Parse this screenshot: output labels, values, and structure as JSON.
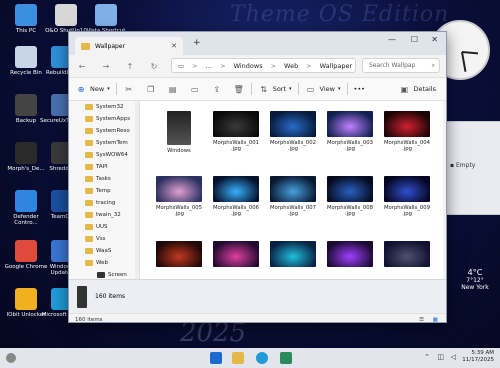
{
  "desktop": {
    "brand_top": "Theme OS Edition",
    "brand_bottom": "2025",
    "icons": [
      {
        "label": "This PC",
        "color": "#3c8fe0"
      },
      {
        "label": "O&O ShutUp10",
        "color": "#d7d7d7"
      },
      {
        "label": "Vista Shortcut",
        "color": "#7fb0e8"
      },
      {
        "label": "Recycle Bin",
        "color": "#c8d4e8"
      },
      {
        "label": "RebuildIcon",
        "color": "#2e8fd8"
      },
      {
        "label": "Backup",
        "color": "#444444"
      },
      {
        "label": "SecureUxTheme",
        "color": "#4a6fb0"
      },
      {
        "label": "Morph's_De...",
        "color": "#2a2a2a"
      },
      {
        "label": "Shredder",
        "color": "#3a3a3a"
      },
      {
        "label": "Defender Contro...",
        "color": "#2f86e0"
      },
      {
        "label": "TeamOS",
        "color": "#1a4fa0"
      },
      {
        "label": "Google Chrome",
        "color": "#e04a3a"
      },
      {
        "label": "Windows Updates",
        "color": "#3a75d0"
      },
      {
        "label": "IObit Unlocker",
        "color": "#f0b020"
      },
      {
        "label": "Microsoft Edge",
        "color": "#1f9bd8"
      }
    ],
    "empty_widget_label": "Empty",
    "weather": {
      "temp": "4°C",
      "detail": "7°12°",
      "location": "New York"
    }
  },
  "window": {
    "tab_title": "Wallpaper",
    "tab_close": "✕",
    "new_tab": "+",
    "controls": {
      "minimize": "—",
      "maximize": "☐",
      "close": "✕"
    },
    "nav": {
      "back": "←",
      "forward": "→",
      "up": "↑",
      "refresh": "↻"
    },
    "breadcrumb": [
      "Windows",
      "Web",
      "Wallpaper"
    ],
    "breadcrumb_sep": ">",
    "more_crumbs": "…",
    "search_placeholder": "Search Wallpap",
    "toolbar": {
      "new": "New",
      "sort": "Sort",
      "view": "View",
      "more": "•••",
      "details": "Details"
    },
    "tree": [
      "System32",
      "SystemApps",
      "SystemReso",
      "SystemTem",
      "SysWOW64",
      "TAPI",
      "Tasks",
      "Temp",
      "tracing",
      "twain_32",
      "UUS",
      "Vss",
      "WaaS",
      "Web",
      "Screen"
    ],
    "files": [
      {
        "name": "Windows",
        "ext": "",
        "colors": [
          "#222",
          "#555"
        ]
      },
      {
        "name": "MorphsWalls_001",
        "ext": ".jpg",
        "colors": [
          "#0a0a0a",
          "#3a3a3a"
        ]
      },
      {
        "name": "MorphsWalls_002",
        "ext": ".jpg",
        "colors": [
          "#061a3a",
          "#2a6ac8"
        ]
      },
      {
        "name": "MorphsWalls_003",
        "ext": ".jpg",
        "colors": [
          "#102050",
          "#c080ff"
        ]
      },
      {
        "name": "MorphsWalls_004",
        "ext": ".jpg",
        "colors": [
          "#1a0505",
          "#d02030"
        ]
      },
      {
        "name": "MorphsWalls_005",
        "ext": ".jpg",
        "colors": [
          "#2a3060",
          "#e0a0d0"
        ]
      },
      {
        "name": "MorphsWalls_006",
        "ext": ".jpg",
        "colors": [
          "#05102a",
          "#3ab0ff"
        ]
      },
      {
        "name": "MorphsWalls_007",
        "ext": ".jpg",
        "colors": [
          "#081830",
          "#4aa0e0"
        ]
      },
      {
        "name": "MorphsWalls_008",
        "ext": ".jpg",
        "colors": [
          "#050a20",
          "#2a60c0"
        ]
      },
      {
        "name": "MorphsWalls_009",
        "ext": ".jpg",
        "colors": [
          "#050520",
          "#3050d0"
        ]
      },
      {
        "name": "",
        "ext": "",
        "colors": [
          "#200808",
          "#c03a20"
        ]
      },
      {
        "name": "",
        "ext": "",
        "colors": [
          "#200a30",
          "#e040a0"
        ]
      },
      {
        "name": "",
        "ext": "",
        "colors": [
          "#0a2040",
          "#20c0e0"
        ]
      },
      {
        "name": "",
        "ext": "",
        "colors": [
          "#1a0a30",
          "#a040ff"
        ]
      },
      {
        "name": "",
        "ext": "",
        "colors": [
          "#101030",
          "#505070"
        ]
      }
    ],
    "detail_count": "160 items",
    "status_count": "160 items"
  },
  "taskbar": {
    "time": "5:39 AM",
    "date": "11/17/2025"
  }
}
